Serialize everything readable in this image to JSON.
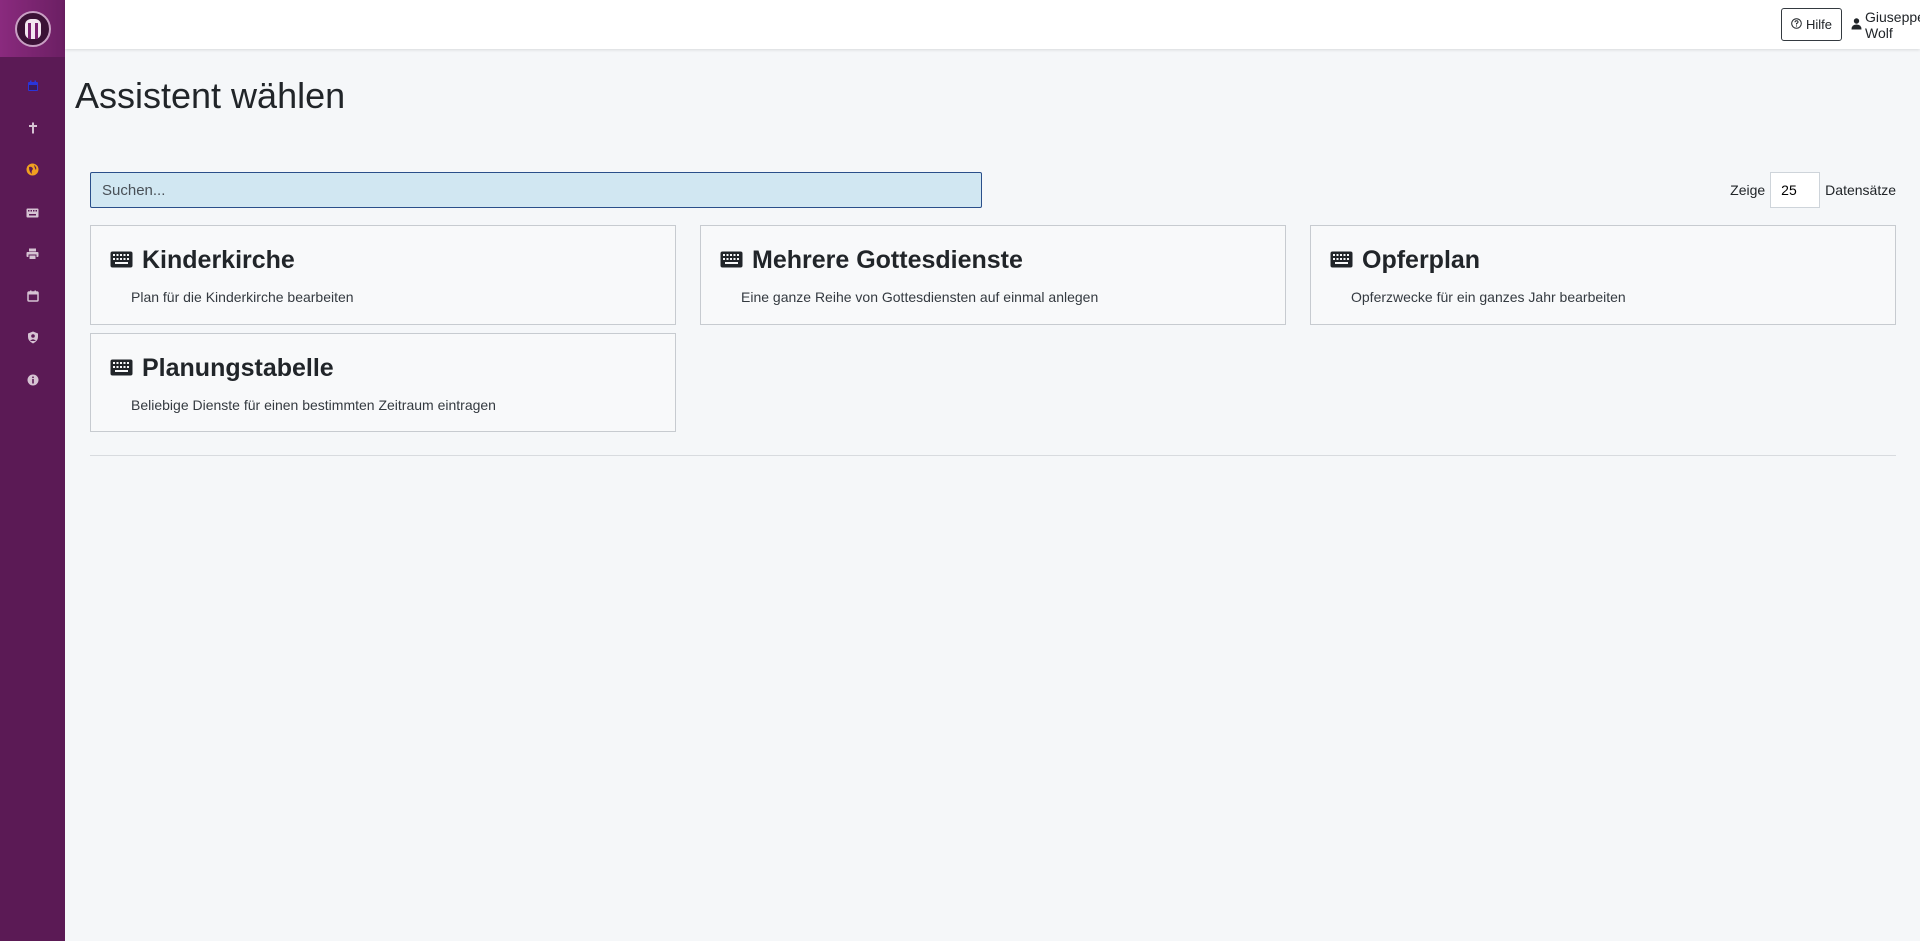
{
  "topbar": {
    "help_label": "Hilfe",
    "user_name": "Giuseppe Wolf"
  },
  "sidebar": {
    "items": [
      {
        "icon": "calendar-icon",
        "color": "#2a35d9"
      },
      {
        "icon": "cross-icon",
        "color": "#d6c3d3"
      },
      {
        "icon": "globe-icon",
        "color": "#f0a020"
      },
      {
        "icon": "keyboard-icon",
        "color": "#d6c3d3"
      },
      {
        "icon": "printer-icon",
        "color": "#d6c3d3"
      },
      {
        "icon": "calendar-outline-icon",
        "color": "#d6c3d3"
      },
      {
        "icon": "user-shield-icon",
        "color": "#d6c3d3"
      },
      {
        "icon": "info-icon",
        "color": "#d6c3d3"
      }
    ]
  },
  "page": {
    "title": "Assistent wählen"
  },
  "search": {
    "placeholder": "Suchen..."
  },
  "records": {
    "prefix": "Zeige",
    "value": "25",
    "suffix": "Datensätze"
  },
  "cards": [
    {
      "title": "Kinderkirche",
      "description": "Plan für die Kinderkirche bearbeiten"
    },
    {
      "title": "Mehrere Gottesdienste",
      "description": "Eine ganze Reihe von Gottesdiensten auf einmal anlegen"
    },
    {
      "title": "Opferplan",
      "description": "Opferzwecke für ein ganzes Jahr bearbeiten"
    },
    {
      "title": "Planungstabelle",
      "description": "Beliebige Dienste für einen bestimmten Zeitraum eintragen"
    }
  ],
  "colors": {
    "sidebar": "#5b1a55",
    "accent": "#2a4f8a",
    "search_bg": "#d1e7f2"
  }
}
